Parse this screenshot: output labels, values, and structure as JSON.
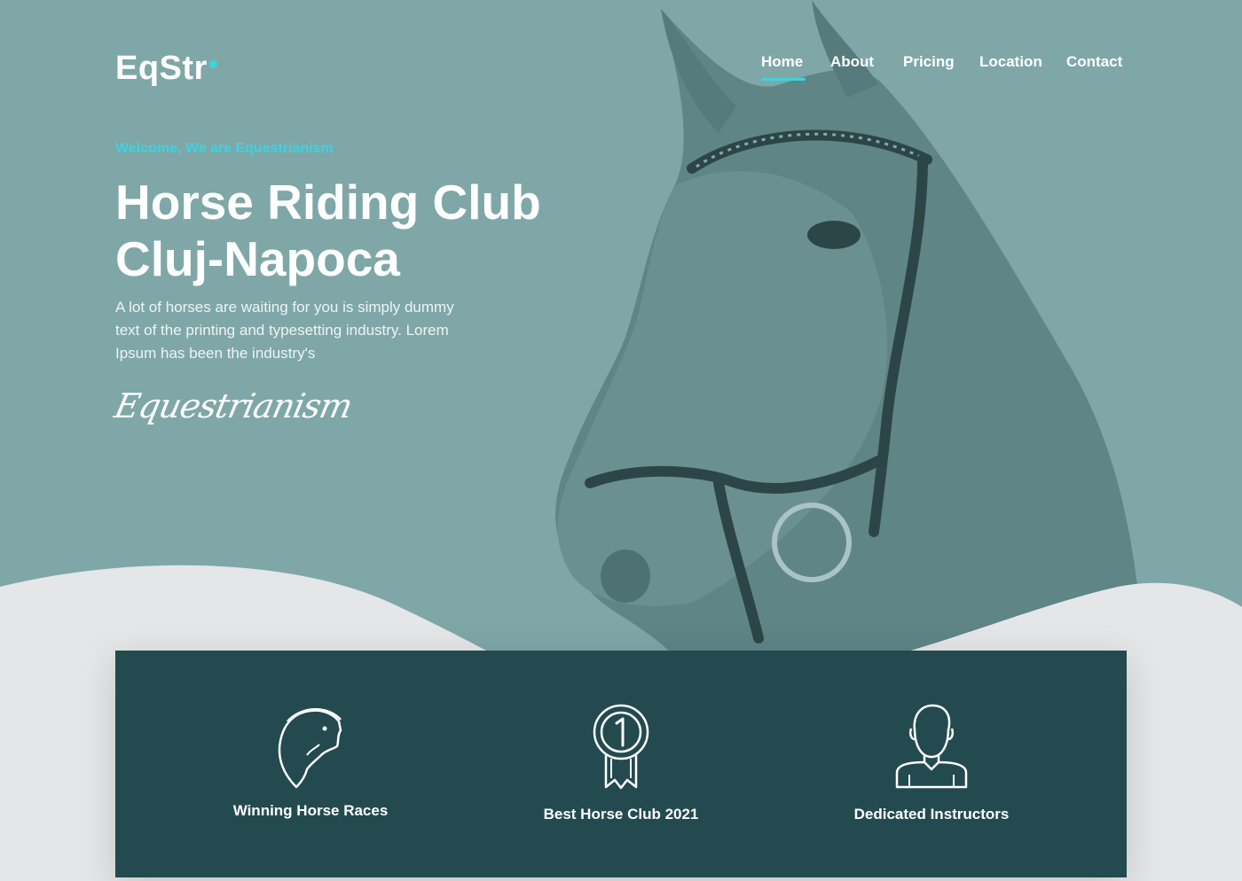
{
  "brand": {
    "logo_text": "EqStr"
  },
  "nav": {
    "items": [
      {
        "label": "Home",
        "active": true
      },
      {
        "label": "About",
        "active": false
      },
      {
        "label": "Pricing",
        "active": false
      },
      {
        "label": "Location",
        "active": false
      },
      {
        "label": "Contact",
        "active": false
      }
    ]
  },
  "hero": {
    "eyebrow": "Welcome, We are Equestrianism",
    "headline_line1": "Horse Riding Club",
    "headline_line2": "Cluj-Napoca",
    "intro": "A lot of horses are waiting for you is simply dummy text of the printing and typesetting industry. Lorem Ipsum has been the industry's",
    "signature": "Equestrianism"
  },
  "features": [
    {
      "icon": "horse-head-icon",
      "label": "Winning Horse Races"
    },
    {
      "icon": "medal-icon",
      "label": "Best Horse Club 2021"
    },
    {
      "icon": "instructor-icon",
      "label": "Dedicated Instructors"
    }
  ],
  "colors": {
    "hero_bg": "#7fa7a8",
    "accent": "#3fd3e0",
    "feature_bg": "#234a4f",
    "page_bg": "#e5e6e8"
  }
}
